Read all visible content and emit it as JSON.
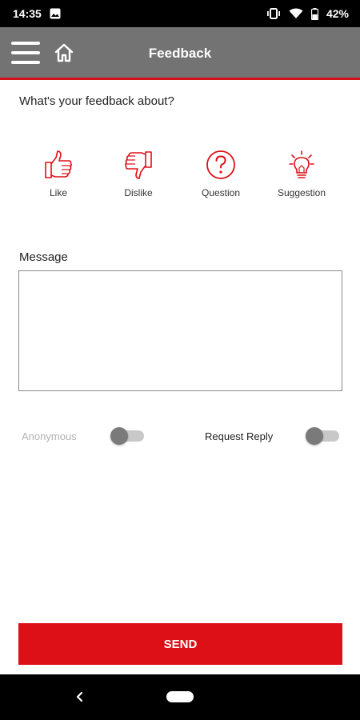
{
  "status_bar": {
    "time": "14:35",
    "battery": "42%",
    "icons": [
      "image-icon",
      "vibrate-icon",
      "wifi-icon",
      "battery-icon"
    ]
  },
  "app_bar": {
    "title": "Feedback",
    "icons": [
      "menu-icon",
      "home-icon"
    ]
  },
  "form": {
    "question": "What's your feedback about?",
    "options": [
      {
        "label": "Like",
        "icon": "thumbs-up-icon"
      },
      {
        "label": "Dislike",
        "icon": "thumbs-down-icon"
      },
      {
        "label": "Question",
        "icon": "question-icon"
      },
      {
        "label": "Suggestion",
        "icon": "lightbulb-icon"
      }
    ],
    "message_label": "Message",
    "message_value": "",
    "anonymous_label": "Anonymous",
    "anonymous_on": false,
    "request_reply_label": "Request Reply",
    "request_reply_on": false,
    "send_label": "SEND"
  },
  "colors": {
    "accent": "#dd1017",
    "app_bar": "#737373",
    "status_bar": "#000000"
  }
}
